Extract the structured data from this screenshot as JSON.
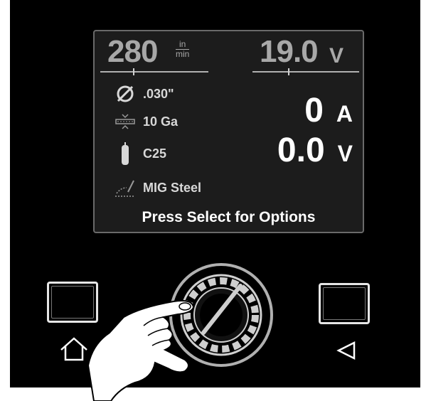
{
  "screen": {
    "wire_feed_speed": {
      "value": "280",
      "unit_top": "in",
      "unit_bottom": "min",
      "level": 0.3
    },
    "voltage_setting": {
      "value": "19.0",
      "unit": "V",
      "level": 0.33
    },
    "wire_diameter": {
      "label": ".030\"",
      "icon": "wire-diameter-icon"
    },
    "material_thickness": {
      "label": "10 Ga",
      "icon": "thickness-icon"
    },
    "gas": {
      "label": "C25",
      "icon": "gas-cylinder-icon"
    },
    "process": {
      "label": "MIG Steel",
      "icon": "mig-torch-icon"
    },
    "amperage": {
      "value": "0",
      "unit": "A"
    },
    "voltage": {
      "value": "0.0",
      "unit": "V"
    },
    "footer": "Press Select for Options"
  },
  "controls": {
    "home_button": {
      "icon": "home-icon"
    },
    "back_button": {
      "icon": "back-triangle-icon"
    },
    "control_knob": {
      "icon": "knob-icon"
    }
  },
  "colors": {
    "panel": "#000000",
    "display": "#1c1c1c",
    "dim_text": "#a8a8a8",
    "text": "#ffffff"
  }
}
